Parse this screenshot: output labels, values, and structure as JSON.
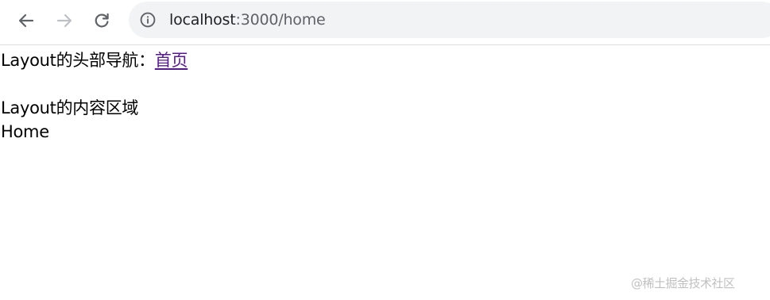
{
  "browser": {
    "url_host": "localhost",
    "url_path": ":3000/home"
  },
  "page": {
    "header_nav_label": "Layout的头部导航：",
    "home_link_label": "首页",
    "content_area_label": "Layout的内容区域",
    "route_content": "Home"
  },
  "watermark": {
    "text": "@稀土掘金技术社区"
  },
  "colors": {
    "visited_link": "#551a8b",
    "omnibox_bg": "#f1f3f4",
    "icon_gray": "#5f6368",
    "disabled_icon": "#bdc1c6"
  }
}
